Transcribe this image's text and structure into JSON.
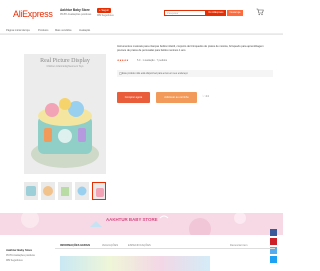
{
  "header": {
    "logo": "AliExpress",
    "store_name": "Aakhtur Baby Store",
    "store_meta": "95.8% Avaliações positivas",
    "follow_label": "+ Seguir",
    "sub_meta": "989 Seguidores",
    "search_placeholder": "Pesquisar",
    "search_aliexpress": "No AliExpress",
    "search_store": "Nesta loja"
  },
  "nav": {
    "items": [
      "Página inicial da loja",
      "Produtos",
      "Mais vendidos",
      "Avaliação"
    ]
  },
  "product": {
    "image_title": "Real Picture Display",
    "image_subtitle": "Children Infant Enlightenment Toys",
    "title": "Instrumentos musicais para crianças bebês infantil, conjunto de brinquedos de pratos de música, brinquedo para aprendizagem precoce de pratos de percussão para bebês meninos 1 ano",
    "stars": "★★★★★",
    "rating_text": "5.0  ·  1 avaliação  ·  7 pedidos",
    "notice": "Este produto não está disponível para envio em seu endereço",
    "buy_label": "Comprar agora",
    "cart_label": "Adicionar ao carrinho",
    "fav_label": "♡ 24"
  },
  "banner": {
    "title": "AAKHTUR BABY STORE"
  },
  "store_side": {
    "name": "Aakhtur Baby Store",
    "meta1": "95.8% Avaliações positivas",
    "meta2": "989 Seguidores"
  },
  "tabs": {
    "items": [
      "INFORMAÇÕES GERAIS",
      "AVALIAÇÕES",
      "ESPECIFICAÇÕES"
    ],
    "report": "Denunciar item"
  },
  "colors": {
    "brand": "#e62e04",
    "buy": "#e95d3a",
    "cart": "#f29a5a",
    "banner": "#f6d9e4"
  }
}
